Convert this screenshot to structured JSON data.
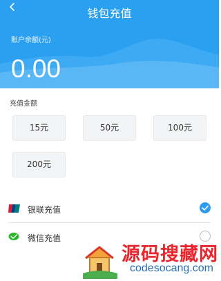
{
  "header": {
    "title": "钱包充值",
    "back_icon": "chevron-left-icon",
    "bg_color": "#2b9ff0"
  },
  "balance": {
    "label": "账户余额(元)",
    "value": "0.00"
  },
  "recharge": {
    "section_label": "充值金额",
    "amounts": [
      "15元",
      "50元",
      "100元",
      "200元"
    ]
  },
  "payment_methods": [
    {
      "label": "银联充值",
      "icon": "unionpay-icon",
      "selected": true
    },
    {
      "label": "微信充值",
      "icon": "wechat-pay-icon",
      "selected": false
    }
  ],
  "watermark": {
    "title": "源码搜藏网",
    "url": "codesocang.com"
  },
  "colors": {
    "accent": "#2d9cf0",
    "watermark_red": "#e8262d"
  }
}
